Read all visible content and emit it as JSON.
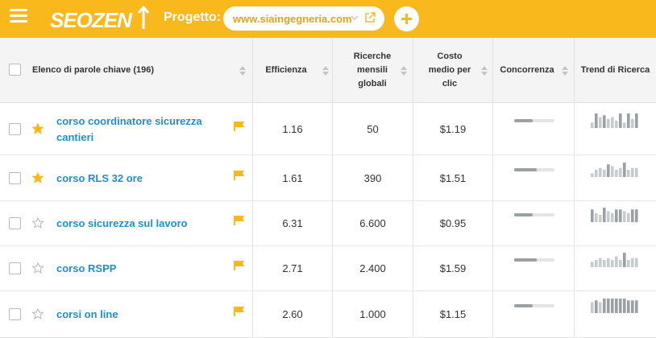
{
  "header": {
    "logo_text": "SEOZEN",
    "project_label": "Progetto:",
    "project_url": "www.siaingegneria.com"
  },
  "colors": {
    "brand": "#f9b81c",
    "link": "#1f8fcf",
    "star_filled": "#f9b81c",
    "flag": "#f9b81c",
    "bar": "#9aa1a4",
    "bar_track": "#e4e4e4"
  },
  "table": {
    "headers": {
      "keywords": "Elenco di parole chiave (196)",
      "efficiency": "Efficienza",
      "searches": "Ricerche mensili globali",
      "cpc": "Costo medio per clic",
      "competition": "Concorrenza",
      "trend": "Trend di Ricerca"
    },
    "rows": [
      {
        "keyword": "corso coordinatore sicurezza cantieri",
        "starred": true,
        "efficiency": "1.16",
        "searches": "50",
        "cpc": "$1.19",
        "competition": 0.45,
        "trend": [
          3,
          8,
          6,
          7,
          5,
          6,
          4,
          8,
          3,
          8,
          5,
          8
        ]
      },
      {
        "keyword": "corso RLS 32 ore",
        "starred": true,
        "efficiency": "1.61",
        "searches": "390",
        "cpc": "$1.51",
        "competition": 0.55,
        "trend": [
          2,
          4,
          5,
          4,
          7,
          6,
          4,
          5,
          8,
          4,
          5,
          5
        ]
      },
      {
        "keyword": "corso sicurezza sul lavoro",
        "starred": false,
        "efficiency": "6.31",
        "searches": "6.600",
        "cpc": "$0.95",
        "competition": 0.45,
        "trend": [
          7,
          5,
          4,
          8,
          6,
          5,
          7,
          7,
          6,
          5,
          7,
          7
        ]
      },
      {
        "keyword": "corso RSPP",
        "starred": false,
        "efficiency": "2.71",
        "searches": "2.400",
        "cpc": "$1.59",
        "competition": 0.55,
        "trend": [
          3,
          4,
          5,
          4,
          5,
          4,
          6,
          4,
          8,
          4,
          5,
          5
        ]
      },
      {
        "keyword": "corsi on line",
        "starred": false,
        "efficiency": "2.60",
        "searches": "1.000",
        "cpc": "$1.15",
        "competition": 0.45,
        "trend": [
          6,
          7,
          6,
          8,
          8,
          8,
          8,
          8,
          8,
          7,
          7,
          7
        ]
      }
    ]
  }
}
